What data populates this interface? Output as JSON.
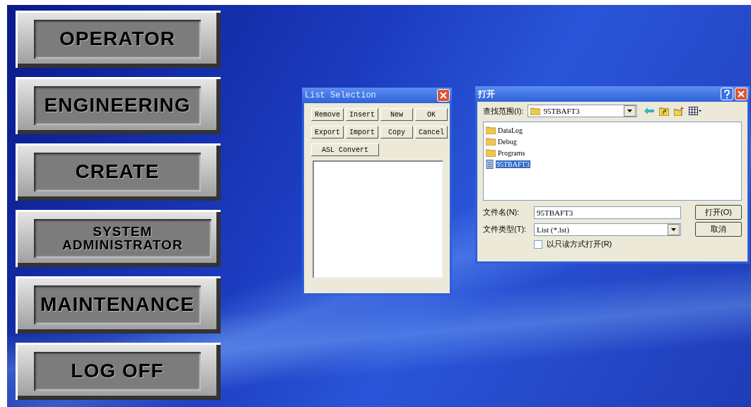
{
  "menu_buttons": [
    {
      "label": "OPERATOR"
    },
    {
      "label": "ENGINEERING"
    },
    {
      "label": "CREATE"
    },
    {
      "label": "SYSTEM ADMINISTRATOR"
    },
    {
      "label": "MAINTENANCE"
    },
    {
      "label": "LOG OFF"
    }
  ],
  "list_selection": {
    "title": "List Selection",
    "button_rows": [
      {
        "buttons": [
          "Remove",
          "Insert",
          "New",
          "OK"
        ]
      },
      {
        "buttons": [
          "Export",
          "Import",
          "Copy",
          "Cancel"
        ]
      },
      {
        "buttons": [
          "ASL Convert"
        ]
      }
    ]
  },
  "open_dialog": {
    "title": "打开",
    "look_in": {
      "label": "查找范围(I):",
      "value": "95TBAFT3"
    },
    "files": [
      {
        "name": "DataLog",
        "kind": "folder",
        "selected": false
      },
      {
        "name": "Debug",
        "kind": "folder",
        "selected": false
      },
      {
        "name": "Programs",
        "kind": "folder",
        "selected": false
      },
      {
        "name": "95TBAFT3",
        "kind": "file",
        "selected": true
      }
    ],
    "file_name": {
      "label": "文件名(N):",
      "value": "95TBAFT3"
    },
    "file_type": {
      "label": "文件类型(T):",
      "value": "List (*.lst)"
    },
    "open_button": "打开(O)",
    "cancel_button": "取消",
    "read_only": {
      "label": "以只读方式打开(R)",
      "checked": false
    }
  }
}
